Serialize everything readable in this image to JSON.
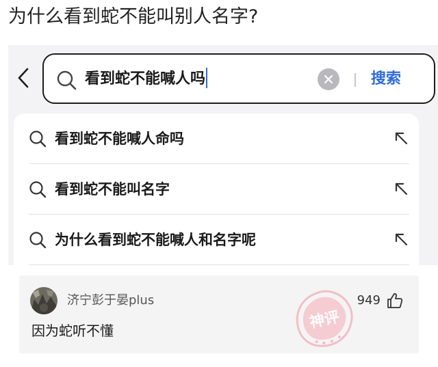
{
  "question": {
    "title": "为什么看到蛇不能叫别人名字?"
  },
  "search": {
    "query": "看到蛇不能喊人吗",
    "submit_label": "搜索",
    "icons": {
      "back": "chevron-left-icon",
      "search": "search-icon",
      "clear": "clear-icon"
    },
    "colors": {
      "accent": "#2f6bd9",
      "border": "#1c1c1c"
    }
  },
  "suggestions": [
    {
      "label": "看到蛇不能喊人命吗"
    },
    {
      "label": "看到蛇不能叫名字"
    },
    {
      "label": "为什么看到蛇不能喊人和名字呢"
    }
  ],
  "comment": {
    "username": "济宁彭于晏plus",
    "likes": "949",
    "text": "因为蛇听不懂",
    "stamp_text": "神评"
  }
}
